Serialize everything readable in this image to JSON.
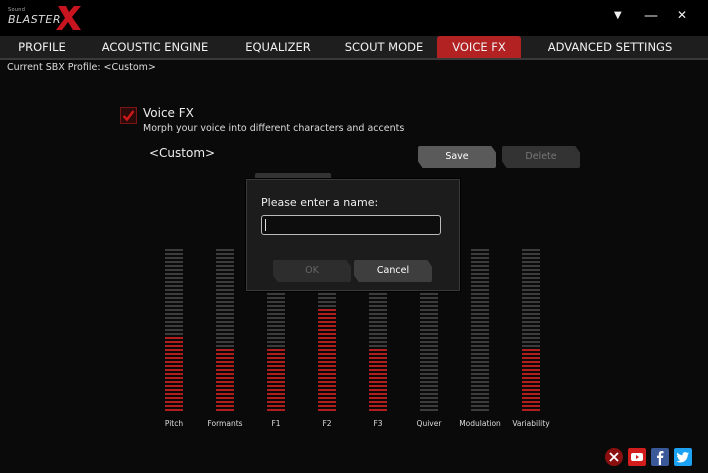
{
  "app": {
    "logo_small": "Sound",
    "logo_text": "BLASTER"
  },
  "window": {
    "menu_icon": "▼",
    "minimize_icon": "—",
    "close_icon": "✕"
  },
  "tabs": [
    {
      "label": "PROFILE",
      "active": false
    },
    {
      "label": "ACOUSTIC ENGINE",
      "active": false
    },
    {
      "label": "EQUALIZER",
      "active": false
    },
    {
      "label": "SCOUT MODE",
      "active": false
    },
    {
      "label": "VOICE FX",
      "active": true
    },
    {
      "label": "ADVANCED SETTINGS",
      "active": false
    }
  ],
  "profile": {
    "label": "Current SBX Profile: <Custom>"
  },
  "voicefx": {
    "enabled": true,
    "title": "Voice FX",
    "description": "Morph your voice into different characters and accents",
    "preset": "<Custom>",
    "save_label": "Save",
    "delete_label": "Delete"
  },
  "sliders": [
    {
      "label": "Pitch",
      "level": 0.47
    },
    {
      "label": "Formants",
      "level": 0.4
    },
    {
      "label": "F1",
      "level": 0.4
    },
    {
      "label": "F2",
      "level": 0.64
    },
    {
      "label": "F3",
      "level": 0.4
    },
    {
      "label": "Quiver",
      "level": 0.0
    },
    {
      "label": "Modulation",
      "level": 0.0
    },
    {
      "label": "Variability",
      "level": 0.4
    }
  ],
  "dialog": {
    "prompt": "Please enter a name:",
    "value": "",
    "ok_label": "OK",
    "cancel_label": "Cancel"
  },
  "social": [
    "mute-icon",
    "youtube-icon",
    "facebook-icon",
    "twitter-icon"
  ],
  "colors": {
    "accent": "#b32222",
    "active_segment": "#b01e1e",
    "inactive_segment": "#3c3c3c"
  }
}
